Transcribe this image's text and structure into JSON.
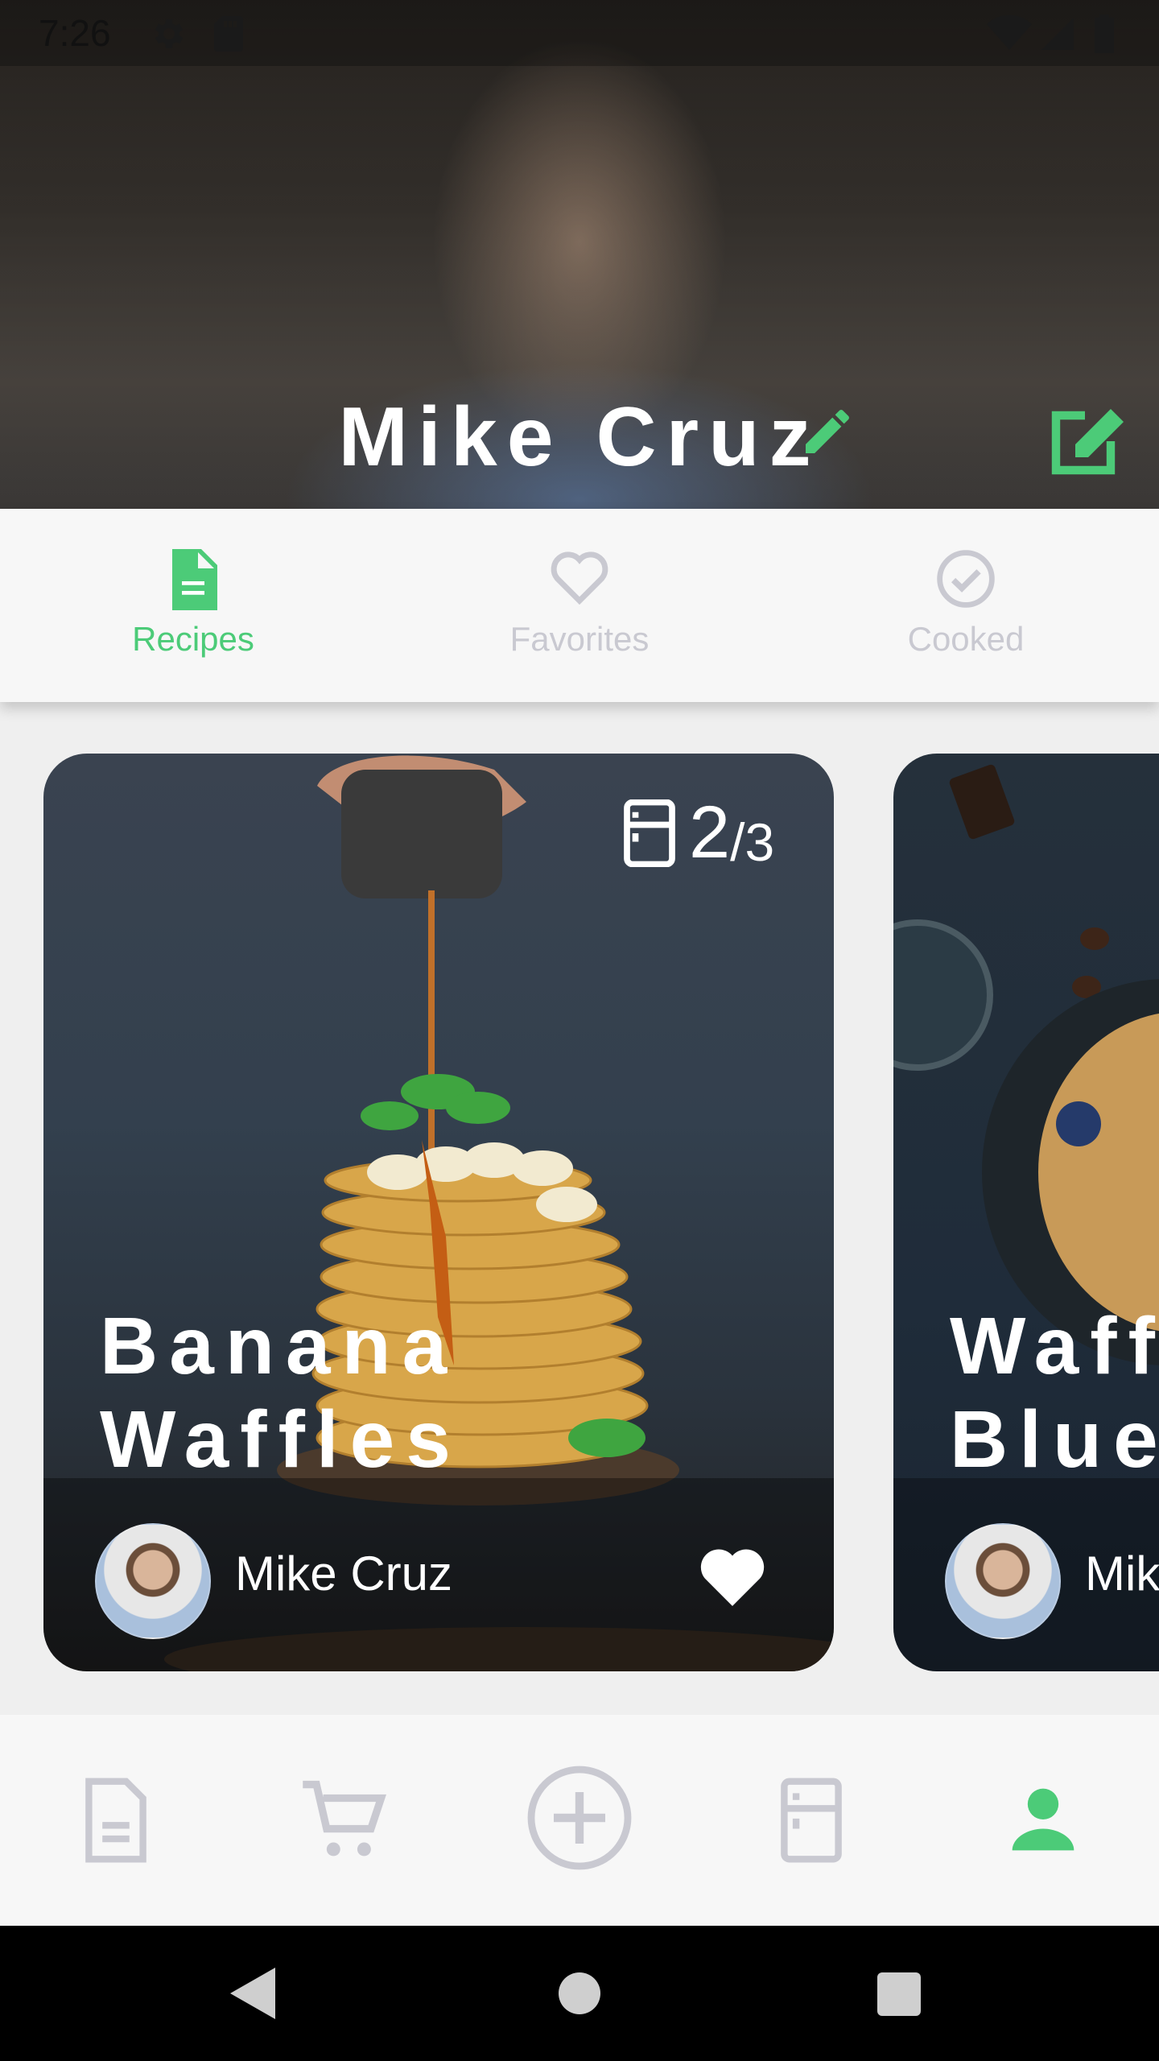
{
  "status_bar": {
    "time": "7:26"
  },
  "profile": {
    "name": "Mike Cruz"
  },
  "tabs": [
    {
      "label": "Recipes",
      "active": true
    },
    {
      "label": "Favorites",
      "active": false
    },
    {
      "label": "Cooked",
      "active": false
    }
  ],
  "recipes": [
    {
      "title_line1": "Banana",
      "title_line2": "Waffles",
      "author": "Mike Cruz",
      "fridge_count": "2",
      "fridge_total": "/3"
    },
    {
      "title_line1": "Waff",
      "title_line2": "Blue",
      "author": "Mik"
    }
  ],
  "colors": {
    "accent": "#4ccb78",
    "inactive": "#c9c9d1",
    "header_text": "#ffffff"
  },
  "icons": [
    "settings-icon",
    "sd-card-icon",
    "wifi-icon",
    "signal-icon",
    "battery-icon",
    "pencil-icon",
    "edit-square-icon",
    "document-icon",
    "heart-outline-icon",
    "check-circle-icon",
    "fridge-icon",
    "heart-icon",
    "cart-icon",
    "add-circle-icon",
    "person-icon",
    "back-icon",
    "home-icon",
    "recents-icon"
  ]
}
